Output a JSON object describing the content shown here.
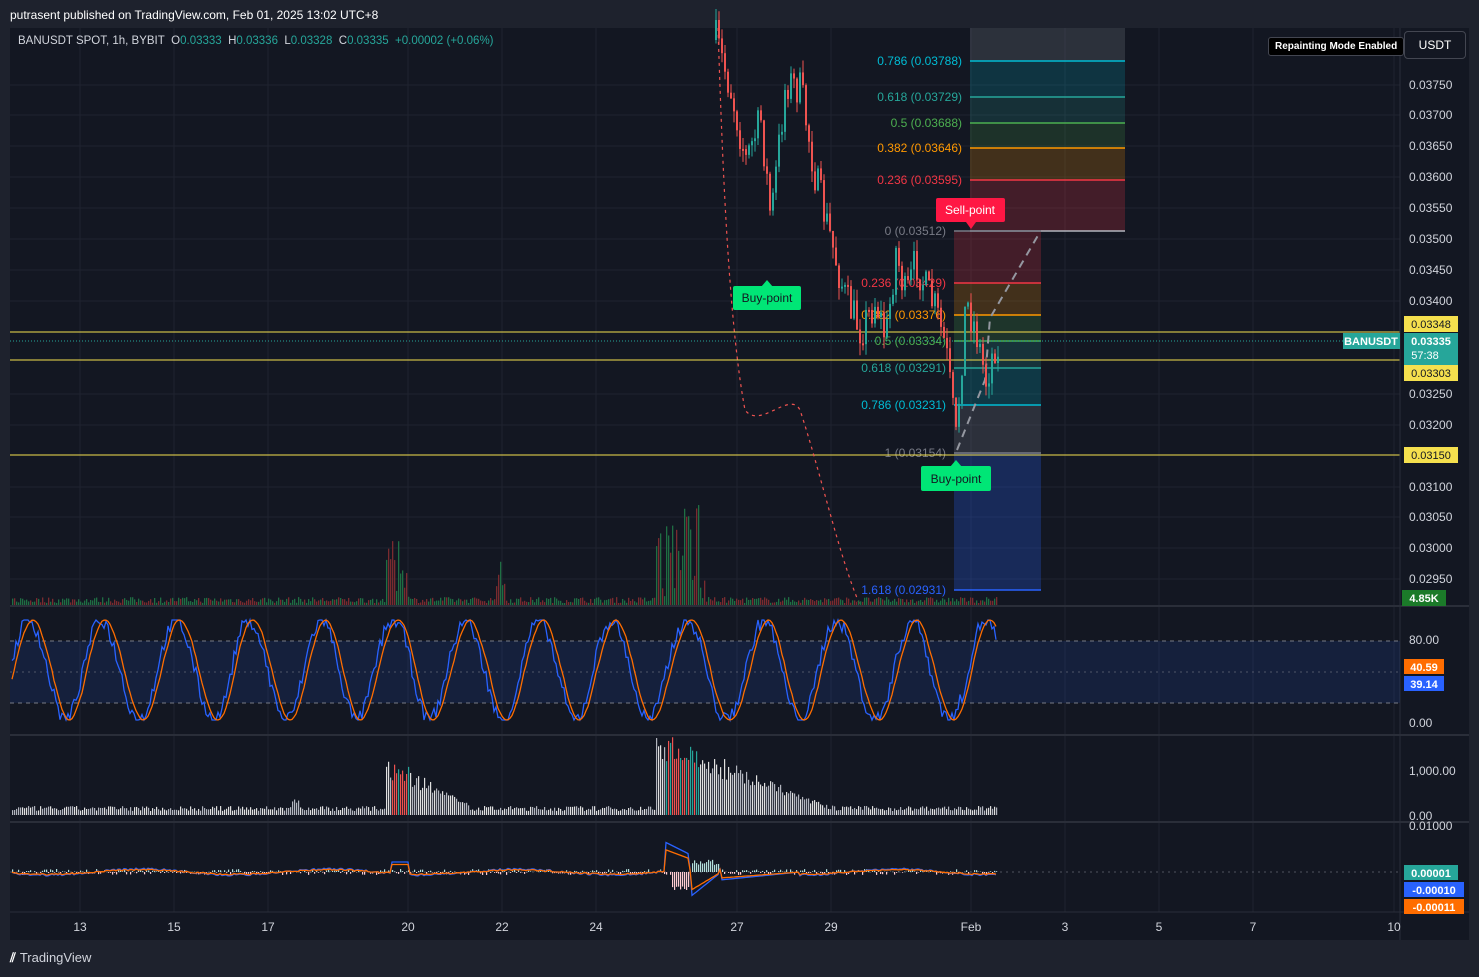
{
  "header": {
    "published_by": "putrasent published on TradingView.com, Feb 01, 2025 13:02 UTC+8"
  },
  "legend": {
    "symbol": "BANUSDT SPOT, 1h, BYBIT",
    "o_label": "O",
    "o_value": "0.03333",
    "h_label": "H",
    "h_value": "0.03336",
    "l_label": "L",
    "l_value": "0.03328",
    "c_label": "C",
    "c_value": "0.03335",
    "change": "+0.00002 (+0.06%)"
  },
  "repaint_badge": "Repainting Mode Enabled",
  "currency_button": "USDT",
  "price_axis": [
    "0.03750",
    "0.03700",
    "0.03650",
    "0.03600",
    "0.03550",
    "0.03500",
    "0.03450",
    "0.03400",
    "0.03250",
    "0.03200",
    "0.03100",
    "0.03050",
    "0.03000",
    "0.02950"
  ],
  "price_tags": {
    "upper_level": "0.03348",
    "symbol": "BANUSDT",
    "last_price": "0.03335",
    "countdown": "57:38",
    "lower_level": "0.03303",
    "support": "0.03150",
    "volume": "4.85K"
  },
  "fib_upper": [
    {
      "label": "0.786 (0.03788)",
      "color": "#00bcd4"
    },
    {
      "label": "0.618 (0.03729)",
      "color": "#26a69a"
    },
    {
      "label": "0.5 (0.03688)",
      "color": "#4caf50"
    },
    {
      "label": "0.382 (0.03646)",
      "color": "#ff9800"
    },
    {
      "label": "0.236 (0.03595)",
      "color": "#f23645"
    }
  ],
  "fib_lower": [
    {
      "label": "0 (0.03512)",
      "color": "#787b86"
    },
    {
      "label": "0.236 (0.03429)",
      "color": "#f23645"
    },
    {
      "label": "0.382 (0.03376)",
      "color": "#ff9800"
    },
    {
      "label": "0.5 (0.03334)",
      "color": "#4caf50"
    },
    {
      "label": "0.618 (0.03291)",
      "color": "#26a69a"
    },
    {
      "label": "0.786 (0.03231)",
      "color": "#00bcd4"
    },
    {
      "label": "1 (0.03154)",
      "color": "#787b86"
    },
    {
      "label": "1.618 (0.02931)",
      "color": "#2962ff"
    }
  ],
  "signals": {
    "buy_label": "Buy-point",
    "sell_label": "Sell-point"
  },
  "stoch": {
    "axis_top": "80.00",
    "axis_bottom": "0.00",
    "k_value": "40.59",
    "d_value": "39.14"
  },
  "volume_osc": {
    "axis_top": "1,000.00",
    "axis_bottom": "0.00"
  },
  "macd": {
    "axis_top": "0.01000",
    "hist": "0.00001",
    "signal": "-0.00010",
    "macd": "-0.00011"
  },
  "time_axis": [
    "13",
    "15",
    "17",
    "20",
    "22",
    "24",
    "27",
    "29",
    "Feb",
    "3",
    "5",
    "7",
    "10"
  ],
  "footer": {
    "brand": "TradingView"
  },
  "colors": {
    "bg": "#131722",
    "up": "#26a69a",
    "down": "#ef5350",
    "level": "#f5e04e",
    "stoch_k": "#2962ff",
    "stoch_d": "#ff6d00",
    "buy": "#00e676",
    "sell": "#ff1744"
  }
}
